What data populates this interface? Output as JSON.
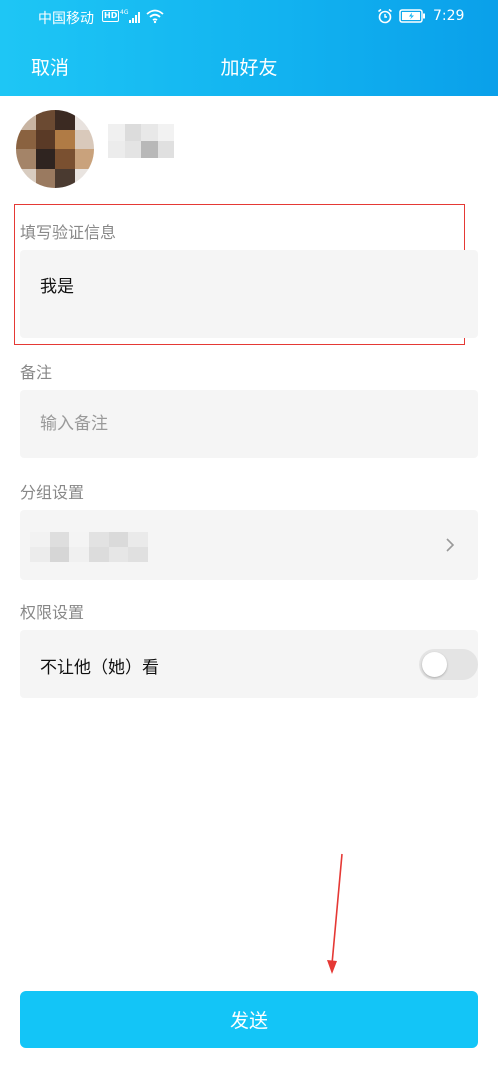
{
  "status_bar": {
    "carrier": "中国移动",
    "hd_badge": "HD",
    "network": "4G",
    "time": "7:29",
    "icons": [
      "signal-icon",
      "wifi-icon",
      "alarm-icon",
      "battery-icon"
    ]
  },
  "nav": {
    "cancel_label": "取消",
    "title": "加好友"
  },
  "profile": {
    "avatar": "blurred-avatar",
    "name": "blurred-name"
  },
  "verify": {
    "label": "填写验证信息",
    "value": "我是"
  },
  "remark": {
    "label": "备注",
    "placeholder": "输入备注",
    "value": ""
  },
  "group": {
    "label": "分组设置",
    "value": "blurred-group",
    "icon": "chevron-right-icon"
  },
  "permission": {
    "label": "权限设置",
    "option_label": "不让他（她）看",
    "toggle_on": false
  },
  "send": {
    "label": "发送"
  },
  "colors": {
    "accent": "#13c5f7",
    "header_start": "#1ec6f5",
    "header_end": "#0aa0ea",
    "highlight_box": "#e53935",
    "field_bg": "#f5f5f5"
  }
}
